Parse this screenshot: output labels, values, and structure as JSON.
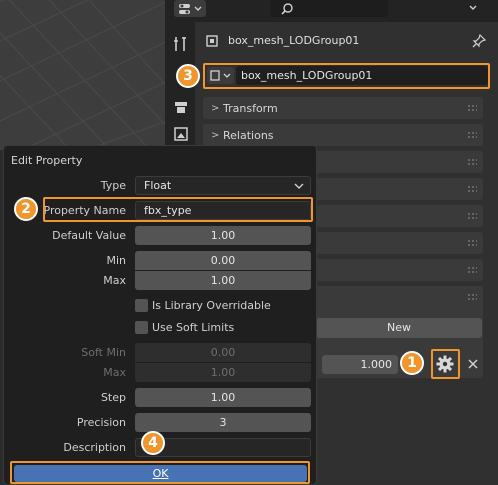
{
  "properties": {
    "object_name": "box_mesh_LODGroup01",
    "object_field_value": "box_mesh_LODGroup01",
    "panels": [
      {
        "label": "Transform"
      },
      {
        "label": "Relations"
      }
    ],
    "new_button_label": "New",
    "custom_prop_value": "1.000"
  },
  "popup": {
    "title": "Edit Property",
    "type_label": "Type",
    "type_value": "Float",
    "property_name_label": "Property Name",
    "property_name_value": "fbx_type",
    "default_value_label": "Default Value",
    "default_value": "1.00",
    "min_label": "Min",
    "min_value": "0.00",
    "max_label": "Max",
    "max_value": "1.00",
    "library_overridable_label": "Is Library Overridable",
    "soft_limits_label": "Use Soft Limits",
    "soft_min_label": "Soft Min",
    "soft_min_value": "0.00",
    "soft_max_label": "Max",
    "soft_max_value": "1.00",
    "step_label": "Step",
    "step_value": "1.00",
    "precision_label": "Precision",
    "precision_value": "3",
    "description_label": "Description",
    "description_value": "",
    "ok_label": "OK"
  },
  "callouts": [
    "1",
    "2",
    "3",
    "4"
  ],
  "colors": {
    "callout": "#f0962c",
    "ok_button": "#4772b3"
  }
}
